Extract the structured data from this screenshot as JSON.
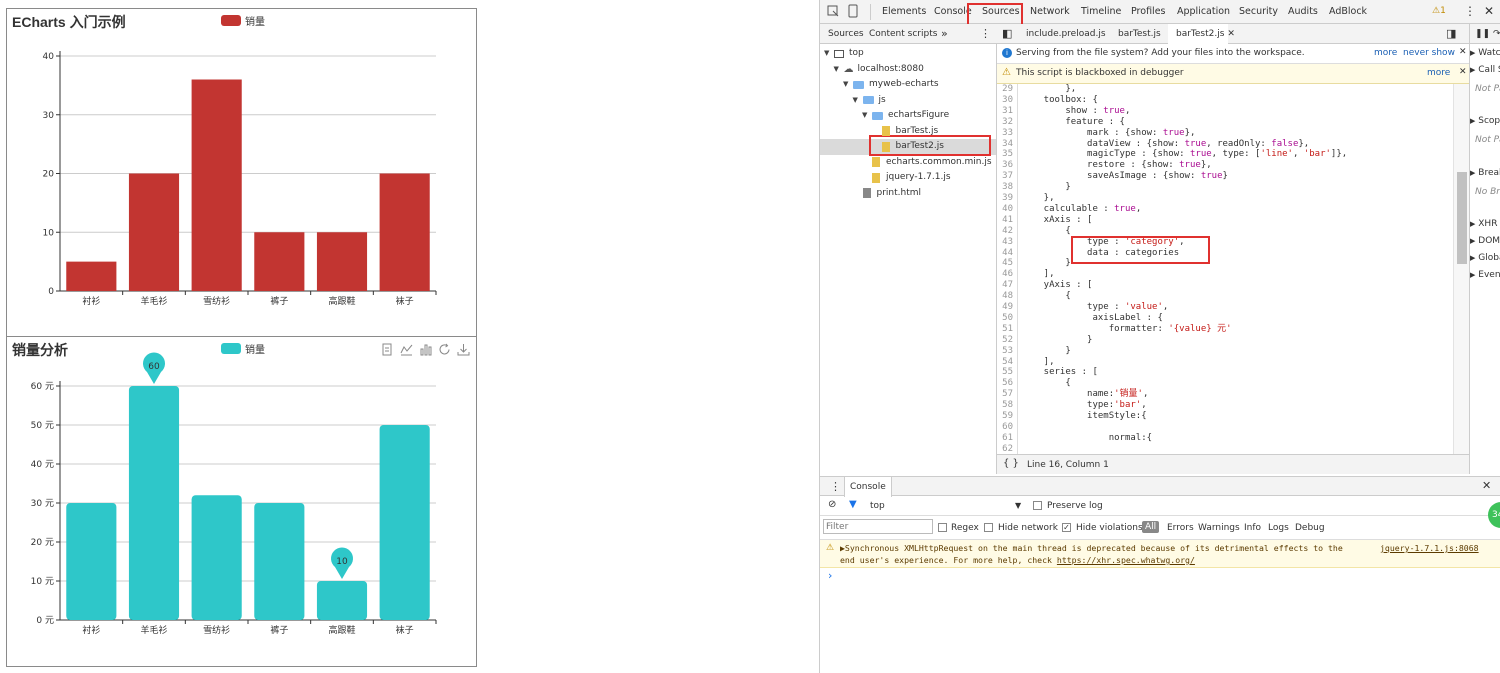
{
  "chart1": {
    "title": "ECharts 入门示例",
    "legend": "销量",
    "color": "#c23531",
    "chart_data": {
      "type": "bar",
      "categories": [
        "衬衫",
        "羊毛衫",
        "雪纺衫",
        "裤子",
        "高跟鞋",
        "袜子"
      ],
      "series": [
        {
          "name": "销量",
          "values": [
            5,
            20,
            36,
            10,
            10,
            20
          ]
        }
      ],
      "ylim": [
        0,
        40
      ],
      "yticks": [
        0,
        10,
        20,
        30,
        40
      ],
      "grid": true
    }
  },
  "chart2": {
    "title": "销量分析",
    "legend": "销量",
    "color": "#2ec7c9",
    "chart_data": {
      "type": "bar",
      "categories": [
        "衬衫",
        "羊毛衫",
        "雪纺衫",
        "裤子",
        "高跟鞋",
        "袜子"
      ],
      "series": [
        {
          "name": "销量",
          "values": [
            30,
            60,
            32,
            30,
            10,
            50
          ]
        }
      ],
      "ylim": [
        0,
        60
      ],
      "yticks": [
        0,
        10,
        20,
        30,
        40,
        50,
        60
      ],
      "ytick_suffix": " 元",
      "mark_points": [
        {
          "category": "羊毛衫",
          "value": 60
        },
        {
          "category": "高跟鞋",
          "value": 10
        }
      ],
      "grid": true
    },
    "toolbox_icons": [
      "data-view-icon",
      "line-chart-icon",
      "bar-chart-icon",
      "restore-icon",
      "save-icon"
    ]
  },
  "devtools": {
    "tabs": [
      "Elements",
      "Console",
      "Sources",
      "Network",
      "Timeline",
      "Profiles",
      "Application",
      "Security",
      "Audits",
      "AdBlock"
    ],
    "warn_count": "1",
    "nav_tabs": [
      "Sources",
      "Content scripts"
    ],
    "file_tabs": [
      "include.preload.js",
      "barTest.js",
      "barTest2.js"
    ],
    "tree": [
      {
        "label": "top",
        "indent": 0,
        "kind": "frame"
      },
      {
        "label": "localhost:8080",
        "indent": 1,
        "kind": "cloud"
      },
      {
        "label": "myweb-echarts",
        "indent": 2,
        "kind": "folder"
      },
      {
        "label": "js",
        "indent": 3,
        "kind": "folder"
      },
      {
        "label": "echartsFigure",
        "indent": 4,
        "kind": "folder"
      },
      {
        "label": "barTest.js",
        "indent": 5,
        "kind": "file"
      },
      {
        "label": "barTest2.js",
        "indent": 5,
        "kind": "file"
      },
      {
        "label": "echarts.common.min.js",
        "indent": 4,
        "kind": "file"
      },
      {
        "label": "jquery-1.7.1.js",
        "indent": 4,
        "kind": "file"
      },
      {
        "label": "print.html",
        "indent": 3,
        "kind": "page"
      }
    ],
    "info_bar": "Serving from the file system? Add your files into the workspace.",
    "info_more": "more",
    "info_never": "never show",
    "warn_bar": "This script is blackboxed in debugger",
    "warn_more": "more",
    "code_lines": [
      {
        "n": "29",
        "t": "        },"
      },
      {
        "n": "30",
        "t": "    toolbox: {"
      },
      {
        "n": "31",
        "t": "        show : true,"
      },
      {
        "n": "32",
        "t": "        feature : {"
      },
      {
        "n": "33",
        "t": "            mark : {show: true},"
      },
      {
        "n": "34",
        "t": "            dataView : {show: true, readOnly: false},"
      },
      {
        "n": "35",
        "t": "            magicType : {show: true, type: ['line', 'bar']},"
      },
      {
        "n": "36",
        "t": "            restore : {show: true},"
      },
      {
        "n": "37",
        "t": "            saveAsImage : {show: true}"
      },
      {
        "n": "38",
        "t": "        }"
      },
      {
        "n": "39",
        "t": "    },"
      },
      {
        "n": "40",
        "t": "    calculable : true,"
      },
      {
        "n": "41",
        "t": "    xAxis : ["
      },
      {
        "n": "42",
        "t": "        {"
      },
      {
        "n": "43",
        "t": "            type : 'category',"
      },
      {
        "n": "44",
        "t": "            data : categories"
      },
      {
        "n": "45",
        "t": "        }"
      },
      {
        "n": "46",
        "t": "    ],"
      },
      {
        "n": "47",
        "t": "    yAxis : ["
      },
      {
        "n": "48",
        "t": "        {"
      },
      {
        "n": "49",
        "t": "            type : 'value',"
      },
      {
        "n": "50",
        "t": "             axisLabel : {"
      },
      {
        "n": "51",
        "t": "                formatter: '{value} 元'"
      },
      {
        "n": "52",
        "t": "            }"
      },
      {
        "n": "53",
        "t": "        }"
      },
      {
        "n": "54",
        "t": "    ],"
      },
      {
        "n": "55",
        "t": "    series : ["
      },
      {
        "n": "56",
        "t": "        {"
      },
      {
        "n": "57",
        "t": "            name:'销量',"
      },
      {
        "n": "58",
        "t": "            type:'bar',"
      },
      {
        "n": "59",
        "t": "            itemStyle:{"
      },
      {
        "n": "60",
        "t": ""
      },
      {
        "n": "61",
        "t": "                normal:{"
      },
      {
        "n": "62",
        "t": ""
      }
    ],
    "status": "Line 16, Column 1",
    "right_panel": [
      "Watch",
      "Call Stack",
      "Not Paused",
      "Scope",
      "Not Paused",
      "Breakpoints",
      "No Breakpoints",
      "XHR",
      "DOM",
      "Global",
      "Event"
    ],
    "drawer_tab": "Console",
    "console_context": "top",
    "preserve_log": "Preserve log",
    "filter_placeholder": "Filter",
    "regex": "Regex",
    "hide_network": "Hide network",
    "hide_violations": "Hide violations",
    "levels": [
      "All",
      "Errors",
      "Warnings",
      "Info",
      "Logs",
      "Debug"
    ],
    "warn_msg_1": "▶Synchronous XMLHttpRequest on the main thread is deprecated because of its detrimental effects to the",
    "warn_msg_2": "end user's experience. For more help, check ",
    "warn_link": "https://xhr.spec.whatwg.org/",
    "warn_src": "jquery-1.7.1.js:8068",
    "prompt": "›",
    "badge": "34"
  }
}
